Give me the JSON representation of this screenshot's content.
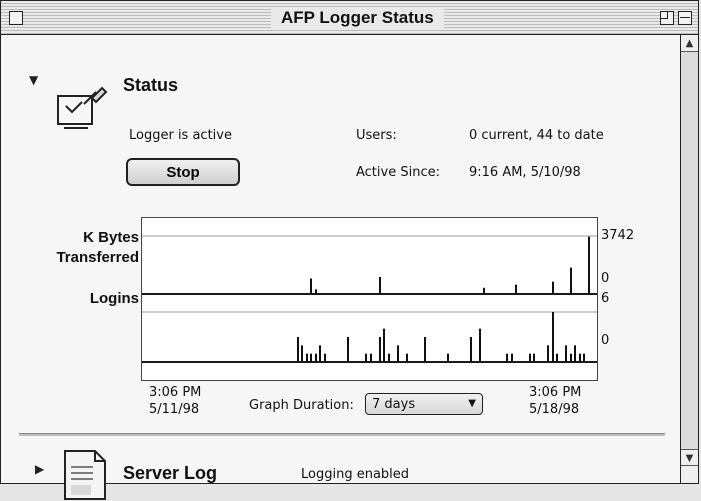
{
  "window": {
    "title": "AFP Logger Status"
  },
  "status": {
    "heading": "Status",
    "logger_state": "Logger is active",
    "stop_label": "Stop",
    "users_label": "Users:",
    "users_value": "0 current, 44 to date",
    "active_since_label": "Active Since:",
    "active_since_value": "9:16 AM, 5/10/98"
  },
  "graph": {
    "kbytes_label": [
      "K Bytes",
      "Transferred"
    ],
    "logins_label": "Logins",
    "kbytes_max": "3742",
    "kbytes_min": "0",
    "logins_max": "6",
    "logins_min": "0",
    "start_time": "3:06 PM",
    "start_date": "5/11/98",
    "end_time": "3:06 PM",
    "end_date": "5/18/98",
    "duration_label": "Graph Duration:",
    "duration_value": "7 days"
  },
  "server_log": {
    "heading": "Server Log",
    "state": "Logging enabled"
  },
  "icons": {
    "status": "dialog-with-pen-icon",
    "server_log": "document-icon",
    "expanded": "disclosure-open-icon",
    "collapsed": "disclosure-closed-icon"
  },
  "chart_data": [
    {
      "type": "bar",
      "title": "K Bytes Transferred",
      "xlabel": "",
      "ylabel": "",
      "ylim": [
        0,
        3742
      ],
      "x_start": "3:06 PM 5/11/98",
      "x_end": "3:06 PM 5/18/98",
      "x": [
        0.37,
        0.38,
        0.52,
        0.75,
        0.82,
        0.9,
        0.94,
        0.98
      ],
      "values": [
        1000,
        300,
        1100,
        400,
        600,
        800,
        1700,
        3700
      ]
    },
    {
      "type": "bar",
      "title": "Logins",
      "xlabel": "",
      "ylabel": "",
      "ylim": [
        0,
        6
      ],
      "x_start": "3:06 PM 5/11/98",
      "x_end": "3:06 PM 5/18/98",
      "x": [
        0.34,
        0.35,
        0.36,
        0.37,
        0.38,
        0.39,
        0.4,
        0.45,
        0.49,
        0.5,
        0.52,
        0.53,
        0.54,
        0.56,
        0.58,
        0.62,
        0.67,
        0.72,
        0.74,
        0.8,
        0.81,
        0.85,
        0.86,
        0.89,
        0.9,
        0.91,
        0.93,
        0.94,
        0.95,
        0.96,
        0.97
      ],
      "values": [
        3,
        2,
        1,
        1,
        1,
        2,
        1,
        3,
        1,
        1,
        3,
        4,
        1,
        2,
        1,
        3,
        1,
        3,
        4,
        1,
        1,
        1,
        1,
        2,
        6,
        1,
        2,
        1,
        2,
        1,
        1
      ]
    }
  ]
}
